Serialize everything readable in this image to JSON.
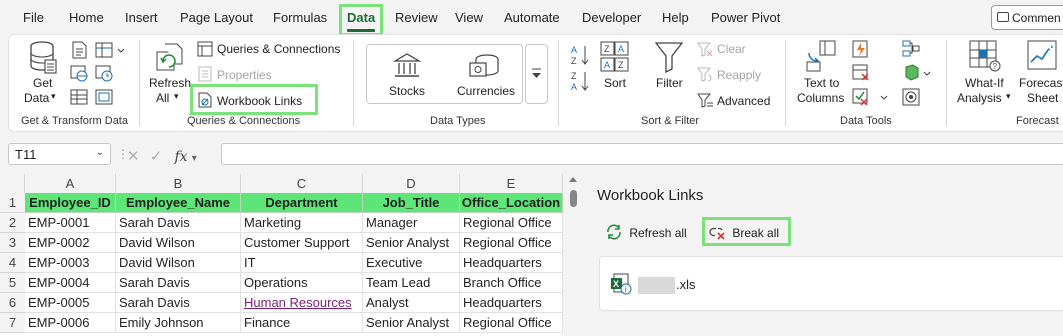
{
  "menu": {
    "tabs": [
      {
        "label": "File"
      },
      {
        "label": "Home"
      },
      {
        "label": "Insert"
      },
      {
        "label": "Page Layout"
      },
      {
        "label": "Formulas"
      },
      {
        "label": "Data",
        "active": true
      },
      {
        "label": "Review"
      },
      {
        "label": "View"
      },
      {
        "label": "Automate"
      },
      {
        "label": "Developer"
      },
      {
        "label": "Help"
      },
      {
        "label": "Power Pivot"
      }
    ],
    "comments_label": "Commen"
  },
  "ribbon": {
    "get_transform": {
      "get_data_line1": "Get",
      "get_data_line2": "Data",
      "group_label": "Get & Transform Data"
    },
    "queries": {
      "refresh_line1": "Refresh",
      "refresh_line2": "All",
      "queries_connections": "Queries & Connections",
      "properties": "Properties",
      "workbook_links": "Workbook Links",
      "group_label": "Queries & Connections"
    },
    "data_types": {
      "stocks": "Stocks",
      "currencies": "Currencies",
      "group_label": "Data Types"
    },
    "sort_filter": {
      "sort": "Sort",
      "filter": "Filter",
      "clear": "Clear",
      "reapply": "Reapply",
      "advanced": "Advanced",
      "group_label": "Sort & Filter"
    },
    "data_tools": {
      "text_to_line1": "Text to",
      "text_to_line2": "Columns",
      "group_label": "Data Tools"
    },
    "forecast": {
      "whatif_line1": "What-If",
      "whatif_line2": "Analysis",
      "sheet_line1": "Forecast",
      "sheet_line2": "Sheet",
      "group_label": "Forecast"
    }
  },
  "formula_bar": {
    "name_box": "T11",
    "fx": "fx",
    "formula": ""
  },
  "sheet": {
    "column_letters": [
      "A",
      "B",
      "C",
      "D",
      "E"
    ],
    "row_numbers": [
      "1",
      "2",
      "3",
      "4",
      "5",
      "6",
      "7"
    ],
    "headers": [
      "Employee_ID",
      "Employee_Name",
      "Department",
      "Job_Title",
      "Office_Location"
    ],
    "rows": [
      [
        "EMP-0001",
        "Sarah Davis",
        "Marketing",
        "Manager",
        "Regional Office"
      ],
      [
        "EMP-0002",
        "David Wilson",
        "Customer Support",
        "Senior Analyst",
        "Regional Office"
      ],
      [
        "EMP-0003",
        "David Wilson",
        "IT",
        "Executive",
        "Headquarters"
      ],
      [
        "EMP-0004",
        "Sarah Davis",
        "Operations",
        "Team Lead",
        "Branch Office"
      ],
      [
        "EMP-0005",
        "Sarah Davis",
        "Human Resources",
        "Analyst",
        "Headquarters"
      ],
      [
        "EMP-0006",
        "Emily Johnson",
        "Finance",
        "Senior Analyst",
        "Regional Office"
      ]
    ]
  },
  "links_pane": {
    "title": "Workbook Links",
    "refresh_all": "Refresh all",
    "break_all": "Break all",
    "file_ext": ".xls"
  },
  "colors": {
    "header_fill": "#5ee578",
    "highlight": "#7be27b",
    "excel_green": "#1e6b39",
    "visited_link": "#7a1f7a"
  }
}
